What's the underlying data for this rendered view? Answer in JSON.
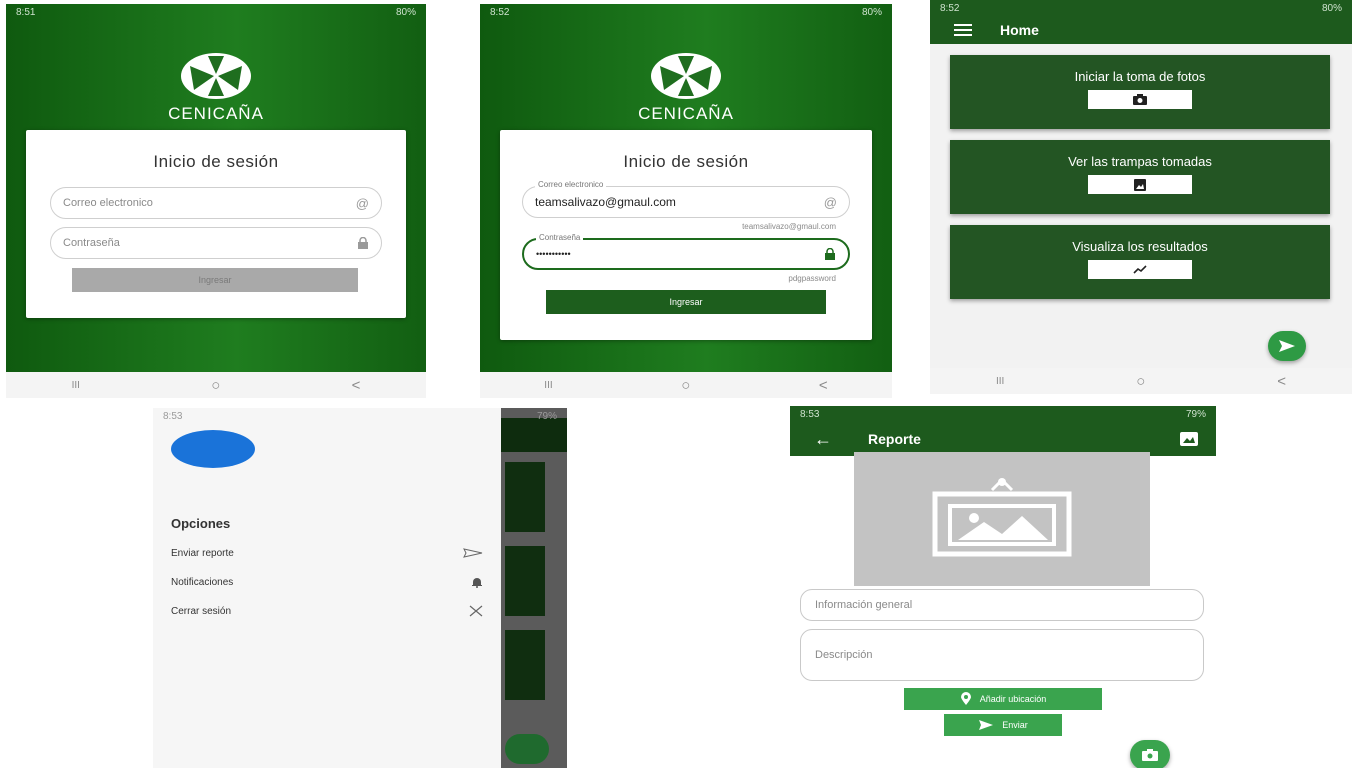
{
  "screen1": {
    "status_time": "8:51",
    "status_right": "80%",
    "brand": "CENICAÑA",
    "title": "Inicio de sesión",
    "email_placeholder": "Correo electronico",
    "password_placeholder": "Contraseña",
    "login_label": "Ingresar"
  },
  "screen2": {
    "status_time": "8:52",
    "status_right": "80%",
    "brand": "CENICAÑA",
    "title": "Inicio de sesión",
    "email_label": "Correo electronico",
    "email_value": "teamsalivazo@gmaul.com",
    "email_helper": "teamsalivazo@gmaul.com",
    "password_label": "Contraseña",
    "password_value": "•••••••••••",
    "password_helper": "pdgpassword",
    "login_label": "Ingresar"
  },
  "screen3": {
    "status_time": "8:52",
    "status_right": "80%",
    "title": "Home",
    "cards": [
      {
        "label": "Iniciar la toma de fotos",
        "icon": "camera-icon"
      },
      {
        "label": "Ver las trampas tomadas",
        "icon": "image-icon"
      },
      {
        "label": "Visualiza los resultados",
        "icon": "trend-icon"
      }
    ]
  },
  "screen4": {
    "status_time": "8:53",
    "status_right": "79%",
    "section_title": "Opciones",
    "items": [
      {
        "label": "Enviar reporte",
        "icon": "send-icon"
      },
      {
        "label": "Notificaciones",
        "icon": "bell-icon"
      },
      {
        "label": "Cerrar sesión",
        "icon": "close-icon"
      }
    ]
  },
  "screen5": {
    "status_time": "8:53",
    "status_right": "79%",
    "title": "Reporte",
    "info_placeholder": "Información general",
    "desc_placeholder": "Descripción",
    "location_label": "Añadir ubicación",
    "send_label": "Enviar"
  },
  "navbar": {
    "recent": "III",
    "home": "○",
    "back": "<"
  },
  "colors": {
    "primary_green": "#1d5a1d",
    "accent_green": "#3aa44e",
    "avatar_blue": "#1a73d9"
  }
}
